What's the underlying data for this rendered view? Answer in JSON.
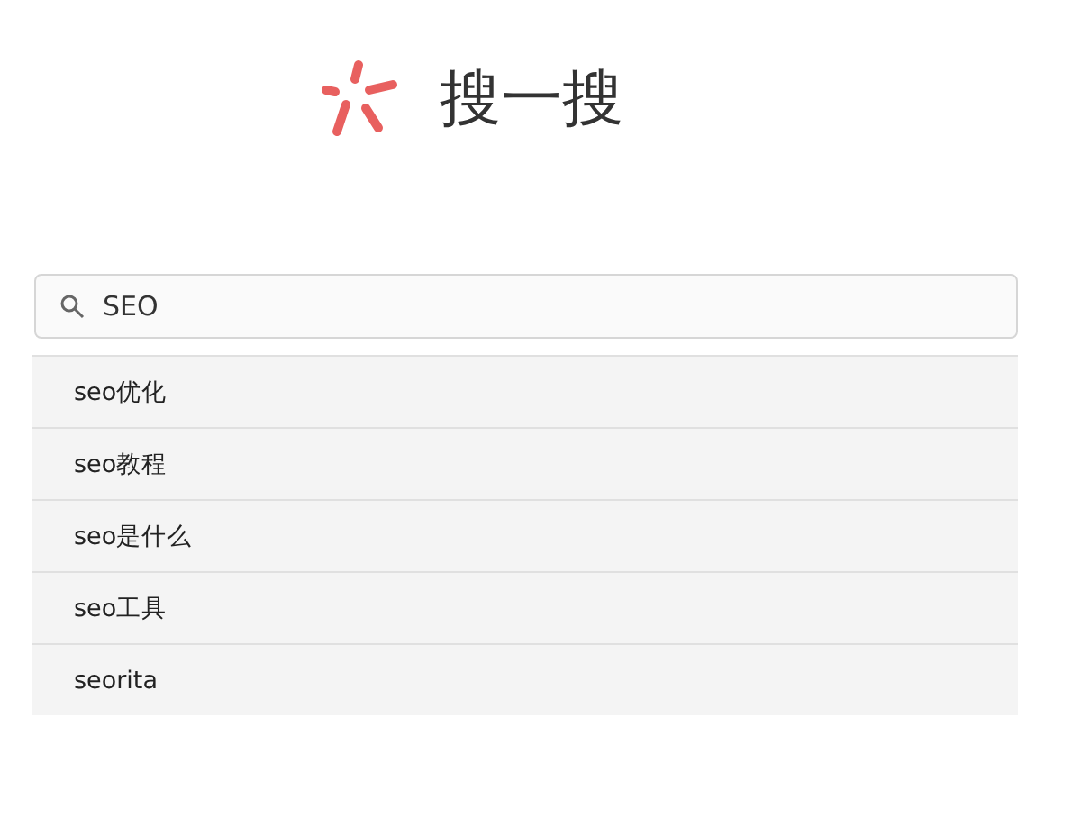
{
  "header": {
    "title": "搜一搜"
  },
  "search": {
    "value": "SEO"
  },
  "suggestions": [
    {
      "text": "seo优化"
    },
    {
      "text": "seo教程"
    },
    {
      "text": "seo是什么"
    },
    {
      "text": "seo工具"
    },
    {
      "text": "seorita"
    }
  ]
}
